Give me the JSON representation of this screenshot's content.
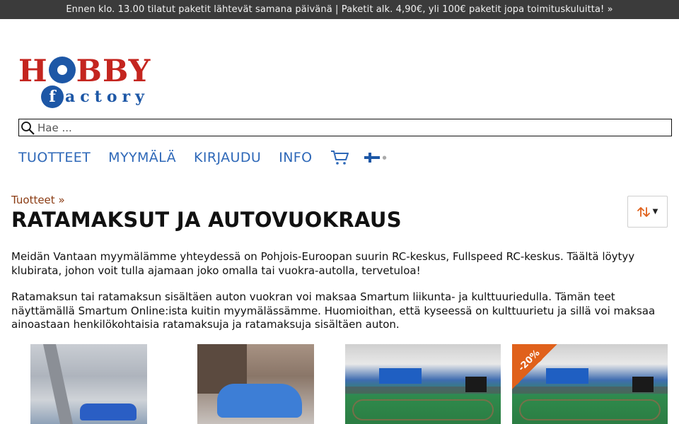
{
  "announcement": "Ennen klo. 13.00 tilatut paketit lähtevät samana päivänä | Paketit alk. 4,90€, yli 100€ paketit jopa toimituskuluitta! »",
  "logo": {
    "word_top": "HOBBY",
    "word_bottom": "actory",
    "letter_f": "f"
  },
  "search": {
    "placeholder": "Hae ...",
    "value": ""
  },
  "nav": {
    "items": [
      "TUOTTEET",
      "MYYMÄLÄ",
      "KIRJAUDU",
      "INFO"
    ],
    "cart_icon": "cart-icon",
    "language_icon": "finland-flag-icon"
  },
  "breadcrumb": {
    "label": "Tuotteet »"
  },
  "page": {
    "title": "RATAMAKSUT JA AUTOVUOKRAUS",
    "paragraphs": [
      "Meidän Vantaan myymälämme yhteydessä on Pohjois-Euroopan suurin RC-keskus, Fullspeed RC-keskus. Täältä löytyy klubirata, johon voit tulla ajamaan joko omalla tai vuokra-autolla, tervetuloa!",
      "Ratamaksun tai ratamaksun sisältäen auton vuokran voi maksaa Smartum liikunta- ja kulttuuriedulla. Tämän teet näyttämällä Smartum Online:ista kuitin myymälässämme. Huomioithan, että kyseessä on kulttuurietu ja sillä voi maksaa ainoastaan henkilökohtaisia ratamaksuja ja ratamaksuja sisältäen auton."
    ]
  },
  "sort": {
    "icon": "sort-arrows-icon",
    "caret": "▼"
  },
  "products": [
    {
      "image": "hall-interior-photo"
    },
    {
      "image": "blue-rc-car-photo"
    },
    {
      "image": "indoor-race-track-photo"
    },
    {
      "image": "indoor-race-track-photo",
      "badge": "-20%"
    }
  ],
  "colors": {
    "accent_link": "#2e68b8",
    "breadcrumb": "#8a3b12",
    "topbar_bg": "#3b3b3b",
    "badge_bg": "#e0611b",
    "logo_red": "#c4251f",
    "logo_blue": "#1d57a6"
  }
}
